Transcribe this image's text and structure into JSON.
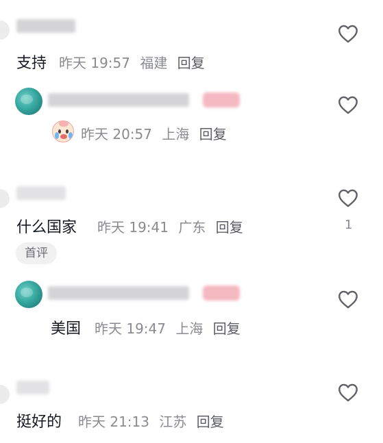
{
  "comments": [
    {
      "text": "支持",
      "time": "昨天 19:57",
      "location": "福建",
      "reply_label": "回复",
      "like_count": ""
    },
    {
      "text": "",
      "time": "昨天 20:57",
      "location": "上海",
      "reply_label": "回复",
      "emoji_icon": "crying-emoji-icon",
      "like_count": ""
    },
    {
      "text": "什么国家",
      "time": "昨天 19:41",
      "location": "广东",
      "reply_label": "回复",
      "like_count": "1",
      "tag": "首评"
    },
    {
      "text": "美国",
      "time": "昨天 19:47",
      "location": "上海",
      "reply_label": "回复",
      "like_count": ""
    },
    {
      "text": "挺好的",
      "time": "昨天 21:13",
      "location": "江苏",
      "reply_label": "回复",
      "like_count": ""
    }
  ],
  "colors": {
    "text": "#161823",
    "meta": "#8a8b91",
    "avatar_teal": "#36a8a0"
  }
}
